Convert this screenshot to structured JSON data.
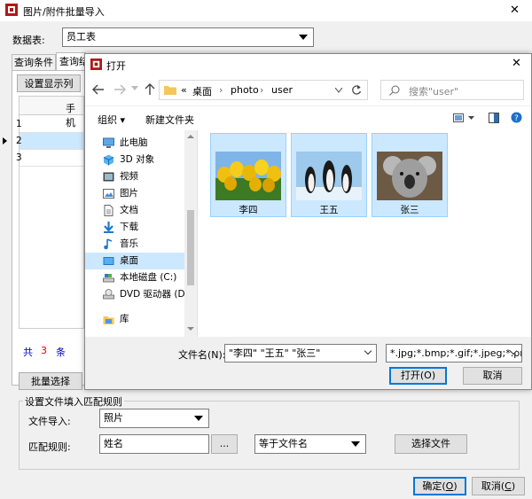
{
  "main": {
    "title": "图片/附件批量导入",
    "close_glyph": "✕",
    "table_label": "数据表:",
    "table_value": "员工表",
    "tabs": [
      "查询条件",
      "查询结"
    ],
    "set_columns_button": "设置显示列",
    "column_header": "手机",
    "rows": [
      "1",
      "2",
      "3"
    ],
    "count_prefix": "共",
    "count_value": "3",
    "count_suffix": "条",
    "batch_select_button": "批量选择",
    "group_title": "设置文件填入匹配规则",
    "file_import_label": "文件导入:",
    "file_import_value": "照片",
    "match_rule_label": "匹配规则:",
    "match_rule_value": "姓名",
    "browse_button": "...",
    "match_mode_value": "等于文件名",
    "choose_file_button": "选择文件",
    "ok_button_text": "确定(",
    "ok_button_key": "O",
    "ok_button_end": ")",
    "cancel_button_text": "取消(",
    "cancel_button_key": "C",
    "cancel_button_end": ")"
  },
  "dialog": {
    "title": "打开",
    "close_glyph": "✕",
    "breadcrumb": [
      "«",
      "桌面",
      "›",
      "photo",
      "›",
      "user"
    ],
    "search_placeholder": "搜索\"user\"",
    "organize_label": "组织 ▾",
    "new_folder_label": "新建文件夹",
    "tree": [
      {
        "label": "此电脑",
        "icon": "computer-icon"
      },
      {
        "label": "3D 对象",
        "icon": "3d-objects-icon"
      },
      {
        "label": "视频",
        "icon": "video-icon"
      },
      {
        "label": "图片",
        "icon": "pictures-icon"
      },
      {
        "label": "文档",
        "icon": "documents-icon"
      },
      {
        "label": "下载",
        "icon": "download-icon"
      },
      {
        "label": "音乐",
        "icon": "music-icon"
      },
      {
        "label": "桌面",
        "icon": "desktop-icon"
      },
      {
        "label": "本地磁盘 (C:)",
        "icon": "drive-icon"
      },
      {
        "label": "DVD 驱动器 (D:",
        "icon": "dvd-icon"
      },
      {
        "label": "库",
        "icon": "library-icon"
      }
    ],
    "files": [
      {
        "name": "李四",
        "icon": "tulips-image"
      },
      {
        "name": "王五",
        "icon": "penguins-image"
      },
      {
        "name": "张三",
        "icon": "koala-image"
      }
    ],
    "filename_label": "文件名(N):",
    "filename_value": "\"李四\" \"王五\" \"张三\"",
    "filter_value": "*.jpg;*.bmp;*.gif;*.jpeg;*.png;",
    "open_button": "打开(O)",
    "cancel_button": "取消"
  },
  "colors": {
    "selection": "#cce8ff",
    "selection_border": "#99d1ff",
    "accent": "#0078d7",
    "count_red": "#e00000",
    "count_blue": "#0000c0"
  }
}
